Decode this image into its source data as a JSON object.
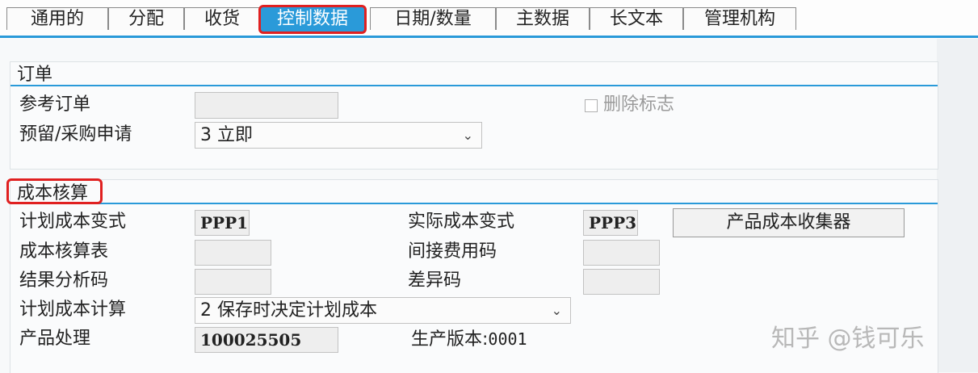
{
  "tabs": [
    {
      "label": "通用的",
      "active": false
    },
    {
      "label": "分配",
      "active": false
    },
    {
      "label": "收货",
      "active": false
    },
    {
      "label": "控制数据",
      "active": true
    },
    {
      "label": "日期/数量",
      "active": false
    },
    {
      "label": "主数据",
      "active": false
    },
    {
      "label": "长文本",
      "active": false
    },
    {
      "label": "管理机构",
      "active": false
    }
  ],
  "order_section": {
    "title": "订单",
    "reference_order_label": "参考订单",
    "reference_order_value": "",
    "deletion_flag_label": "删除标志",
    "deletion_flag_checked": false,
    "reservation_label": "预留/采购申请",
    "reservation_value": "3 立即"
  },
  "costing_section": {
    "title": "成本核算",
    "planned_cost_variant_label": "计划成本变式",
    "planned_cost_variant_value": "PPP1",
    "actual_cost_variant_label": "实际成本变式",
    "actual_cost_variant_value": "PPP3",
    "product_cost_collector_button": "产品成本收集器",
    "costing_sheet_label": "成本核算表",
    "costing_sheet_value": "",
    "overhead_key_label": "间接费用码",
    "overhead_key_value": "",
    "results_analysis_key_label": "结果分析码",
    "results_analysis_key_value": "",
    "variance_key_label": "差异码",
    "variance_key_value": "",
    "planned_cost_calc_label": "计划成本计算",
    "planned_cost_calc_value": "2 保存时决定计划成本",
    "product_processing_label": "产品处理",
    "product_processing_value": "100025505",
    "production_version_label": "生产版本:",
    "production_version_value": "0001"
  },
  "watermark": "知乎 @钱可乐",
  "colors": {
    "accent": "#2a9ad9",
    "highlight": "#e02020"
  }
}
